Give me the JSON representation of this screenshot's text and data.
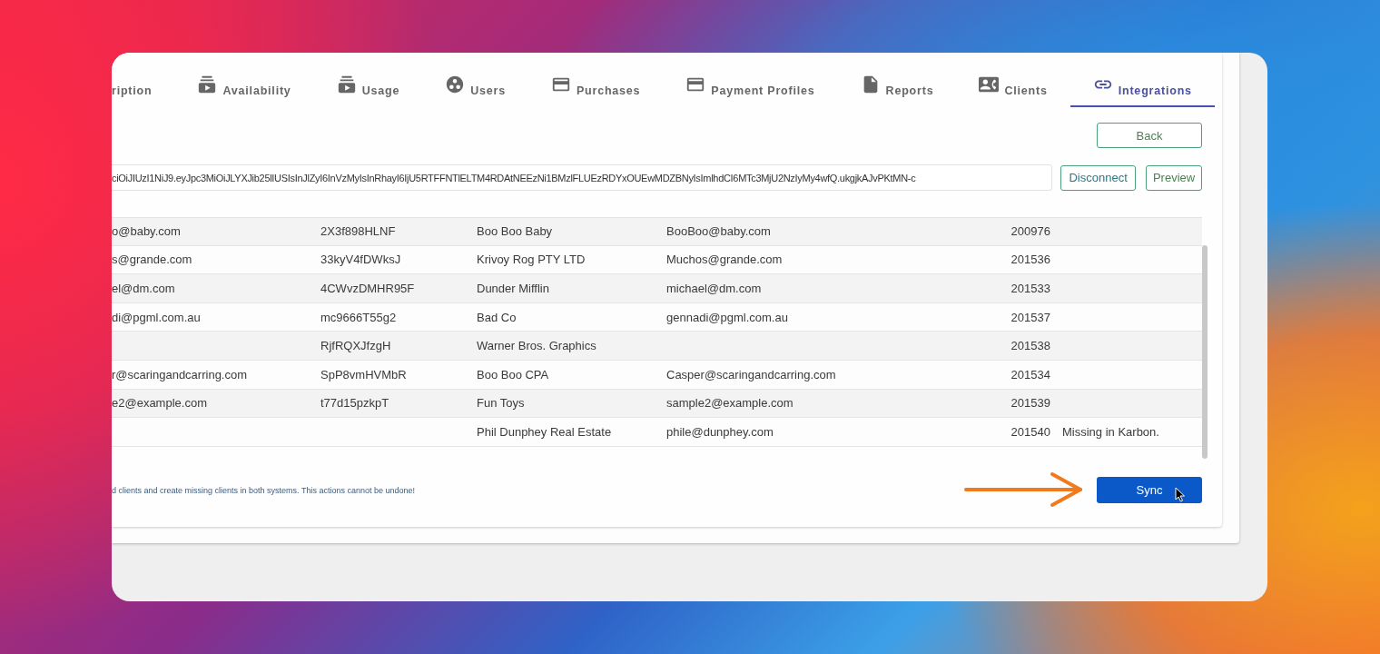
{
  "tabs": [
    {
      "label": "ription",
      "kind": "plain",
      "selected": false
    },
    {
      "label": "Availability",
      "kind": "subscription",
      "selected": false
    },
    {
      "label": "Usage",
      "kind": "subscription",
      "selected": false
    },
    {
      "label": "Users",
      "kind": "group",
      "selected": false
    },
    {
      "label": "Purchases",
      "kind": "card",
      "selected": false
    },
    {
      "label": "Payment Profiles",
      "kind": "card",
      "selected": false
    },
    {
      "label": "Reports",
      "kind": "file",
      "selected": false
    },
    {
      "label": "Clients",
      "kind": "contact",
      "selected": false
    },
    {
      "label": "Integrations",
      "kind": "link",
      "selected": true
    }
  ],
  "back_button": "Back",
  "token_field": {
    "value": "ciOiJIUzI1NiJ9.eyJpc3MiOiJLYXJib25lIUSIsInJlZyI6InVzMyIsInRhayI6IjU5RTFFNTlELTM4RDAtNEEzNi1BMzlFLUEzRDYxOUEwMDZBNyIsImlhdCI6MTc3MjU2NzIyMy4wfQ.ukgjkAJvPKtMN-c"
  },
  "token_buttons": [
    "Disconnect",
    "Preview"
  ],
  "table": {
    "rows": [
      {
        "column_1": "o@baby.com",
        "column_2": "2X3f898HLNF",
        "column_3": "Boo Boo Baby",
        "column_4": "BooBoo@baby.com",
        "column_5": "200976"
      },
      {
        "column_1": "s@grande.com",
        "column_2": "33kyV4fDWksJ",
        "column_3": "Krivoy Rog PTY LTD",
        "column_4": "Muchos@grande.com",
        "column_5": "201536"
      },
      {
        "column_1": "el@dm.com",
        "column_2": "4CWvzDMHR95F",
        "column_3": "Dunder Mifflin",
        "column_4": "michael@dm.com",
        "column_5": "201533"
      },
      {
        "column_1": "di@pgml.com.au",
        "column_2": "mc9666T55g2",
        "column_3": "Bad Co",
        "column_4": "gennadi@pgml.com.au",
        "column_5": "201537"
      },
      {
        "column_2": "RjfRQXJfzgH",
        "column_3": "Warner Bros. Graphics",
        "column_5": "201538"
      },
      {
        "column_1": "r@scaringandcarring.com",
        "column_2": "SpP8vmHVMbR",
        "column_3": "Boo Boo CPA",
        "column_4": "Casper@scaringandcarring.com",
        "column_5": "201534"
      },
      {
        "column_1": "e2@example.com",
        "column_2": "t77d15pzkpT",
        "column_3": "Fun Toys",
        "column_4": "sample2@example.com",
        "column_5": "201539"
      },
      {
        "column_3": "Phil Dunphey Real Estate",
        "column_4": "phile@dunphey.com",
        "column_5": "201540",
        "column_6": "Missing in Karbon."
      }
    ]
  },
  "sync_note": "d clients and create missing clients in both systems. This actions cannot be undone!",
  "sync_button": "Sync"
}
